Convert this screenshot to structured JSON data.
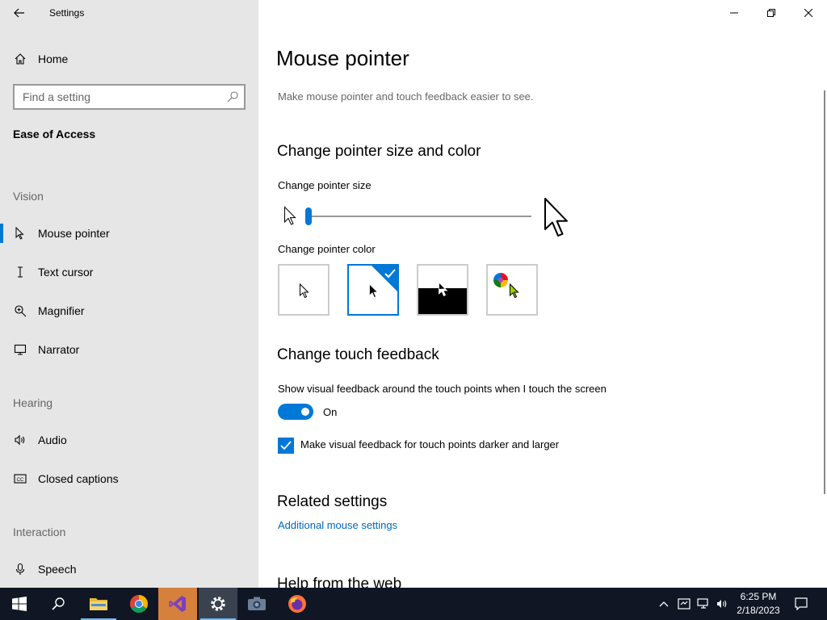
{
  "window": {
    "title": "Settings"
  },
  "sidebar": {
    "home_label": "Home",
    "search_placeholder": "Find a setting",
    "section_title": "Ease of Access",
    "groups": {
      "vision": "Vision",
      "hearing": "Hearing",
      "interaction": "Interaction"
    },
    "items": [
      {
        "label": "Mouse pointer",
        "icon": "mouse-pointer-icon",
        "selected": true
      },
      {
        "label": "Text cursor",
        "icon": "text-cursor-icon"
      },
      {
        "label": "Magnifier",
        "icon": "magnifier-icon"
      },
      {
        "label": "Narrator",
        "icon": "narrator-icon"
      },
      {
        "label": "Audio",
        "icon": "audio-icon"
      },
      {
        "label": "Closed captions",
        "icon": "closed-captions-icon"
      },
      {
        "label": "Speech",
        "icon": "microphone-icon"
      }
    ]
  },
  "main": {
    "title": "Mouse pointer",
    "description": "Make mouse pointer and touch feedback easier to see.",
    "pointer_section": {
      "heading": "Change pointer size and color",
      "size_label": "Change pointer size",
      "size_value_fraction": 0.0,
      "color_label": "Change pointer color",
      "color_options": [
        {
          "name": "white",
          "selected": false
        },
        {
          "name": "black",
          "selected": true
        },
        {
          "name": "inverted",
          "selected": false
        },
        {
          "name": "custom",
          "selected": false
        }
      ]
    },
    "touch_section": {
      "heading": "Change touch feedback",
      "toggle_label": "Show visual feedback around the touch points when I touch the screen",
      "toggle_state": "On",
      "checkbox_label": "Make visual feedback for touch points darker and larger",
      "checkbox_checked": true
    },
    "related": {
      "heading": "Related settings",
      "link": "Additional mouse settings"
    },
    "help": {
      "heading": "Help from the web"
    }
  },
  "taskbar": {
    "time": "6:25 PM",
    "date": "2/18/2023"
  },
  "colors": {
    "accent": "#0078d7",
    "link": "#0067b8",
    "sidebar_bg": "#e6e6e6",
    "taskbar_bg": "#101624"
  }
}
